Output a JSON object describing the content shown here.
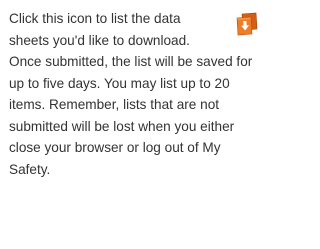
{
  "help": {
    "text": "Click this icon to list the data sheets you'd like to download. Once submitted, the list will be saved for up to five days. You may list up to 20 items. Remember, lists that are not submitted will be lost when you either close your browser or log out of My Safety."
  },
  "icon": {
    "name": "download-list-icon",
    "colors": {
      "body": "#e8731f",
      "dark": "#b44e0c",
      "arrow": "#ffffff"
    }
  }
}
